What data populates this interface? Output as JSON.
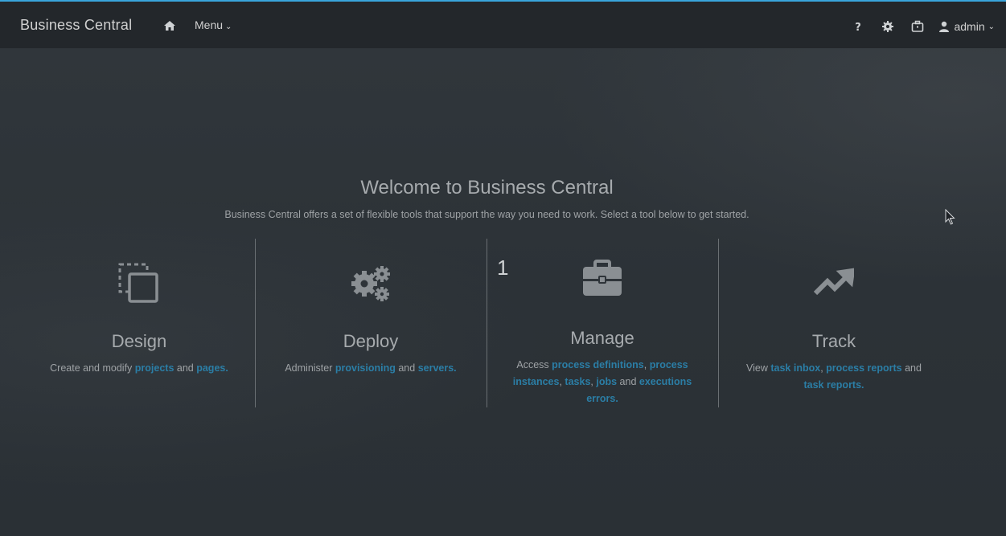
{
  "header": {
    "brand": "Business Central",
    "menu_label": "Menu",
    "user_label": "admin"
  },
  "icons": {
    "home": "home-icon",
    "help": "question-icon",
    "settings": "gear-icon",
    "tasks": "briefcase-icon",
    "user": "user-icon"
  },
  "hero": {
    "title": "Welcome to Business Central",
    "subtitle": "Business Central offers a set of flexible tools that support the way you need to work. Select a tool below to get started."
  },
  "tools": {
    "design": {
      "title": "Design",
      "prefix": "Create and modify ",
      "link1": "projects",
      "and": " and ",
      "link2": "pages."
    },
    "deploy": {
      "title": "Deploy",
      "prefix": "Administer ",
      "link1": "provisioning",
      "and": " and ",
      "link2": "servers."
    },
    "manage": {
      "title": "Manage",
      "badge": "1",
      "prefix": "Access ",
      "link1": "process definitions",
      "sep1": ", ",
      "link2": "process instances",
      "sep2": ", ",
      "link3": "tasks",
      "sep3": ", ",
      "link4": "jobs",
      "and": " and ",
      "link5": "executions errors."
    },
    "track": {
      "title": "Track",
      "prefix": "View ",
      "link1": "task inbox",
      "sep1": ", ",
      "link2": "process reports",
      "and": " and ",
      "link3": "task reports."
    }
  },
  "colors": {
    "accent": "#39a5dc",
    "link": "#2b7ea6",
    "topbar": "#23272b"
  }
}
